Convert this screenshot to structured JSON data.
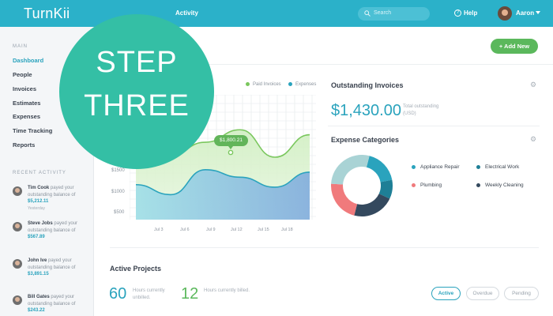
{
  "topbar": {
    "brand": "TurnKii",
    "nav": [
      "Activity"
    ],
    "search_placeholder": "Search",
    "help": "Help",
    "help_icon": "?",
    "user": "Aaron"
  },
  "sidebar": {
    "main_heading": "MAIN",
    "items": [
      "Dashboard",
      "People",
      "Invoices",
      "Estimates",
      "Expenses",
      "Time Tracking",
      "Reports"
    ],
    "active_item": "Dashboard",
    "recent_heading": "RECENT ACTIVITY",
    "activity": [
      {
        "name": "Tim Cook",
        "text": " payed your outstanding balance of",
        "amount": "$5,212.11",
        "when": "Yesterday"
      },
      {
        "name": "Steve Jobs",
        "text": " payed your outstanding balance of",
        "amount": "$567.89",
        "when": ""
      },
      {
        "name": "John Ive",
        "text": " payed your outstanding balance of",
        "amount": "$3,891.15",
        "when": ""
      },
      {
        "name": "Bill Gates",
        "text": " payed your outstanding balance of",
        "amount": "$243.22",
        "when": ""
      }
    ]
  },
  "toolbar": {
    "add_new": "+ Add New"
  },
  "chart": {
    "legend": [
      "Paid Invoices",
      "Expenses"
    ],
    "tooltip": "$1,800.21",
    "yticks": [
      "$1500",
      "$1000",
      "$500"
    ],
    "xticks": [
      "Jul 3",
      "Jul 6",
      "Jul 9",
      "Jul 12",
      "Jul 15",
      "Jul 18"
    ]
  },
  "chart_data": {
    "type": "area",
    "x": [
      "Jul 3",
      "Jul 6",
      "Jul 9",
      "Jul 12",
      "Jul 15",
      "Jul 18"
    ],
    "series": [
      {
        "name": "Paid Invoices",
        "values": [
          1850,
          1300,
          1550,
          1800,
          1250,
          1700
        ]
      },
      {
        "name": "Expenses",
        "values": [
          700,
          500,
          1000,
          850,
          650,
          950
        ]
      }
    ],
    "yticks": [
      "$1500",
      "$1000",
      "$500"
    ],
    "ylim": [
      0,
      2500
    ],
    "grid": true,
    "legend_position": "top-right",
    "colors": {
      "paid": "#7ac75d",
      "expenses": "#2aa3bd"
    }
  },
  "outstanding": {
    "title": "Outstanding Invoices",
    "amount": "$1,430.00",
    "note": "Total outstanding (USD)"
  },
  "expenses": {
    "title": "Expense Categories",
    "categories": [
      {
        "label": "Appliance Repair",
        "color": "#2aa3bd",
        "value": 18
      },
      {
        "label": "Electrical Work",
        "color": "#1e7f96",
        "value": 10
      },
      {
        "label": "Plumbing",
        "color": "#f07a7c",
        "value": 22
      },
      {
        "label": "Weekly Cleaning",
        "color": "#34495e",
        "value": 22
      }
    ],
    "other_value": 28,
    "other_color": "#a9d3d5"
  },
  "projects": {
    "title": "Active Projects",
    "stats": [
      {
        "value": "60",
        "note": "Hours currently unbilled.",
        "color": "#2aa3bd"
      },
      {
        "value": "12",
        "note": "Hours currently billed.",
        "color": "#5bb85c"
      }
    ],
    "filters": [
      "Active",
      "Overdue",
      "Pending"
    ]
  },
  "overlay": {
    "line1": "STEP",
    "line2": "THREE"
  }
}
